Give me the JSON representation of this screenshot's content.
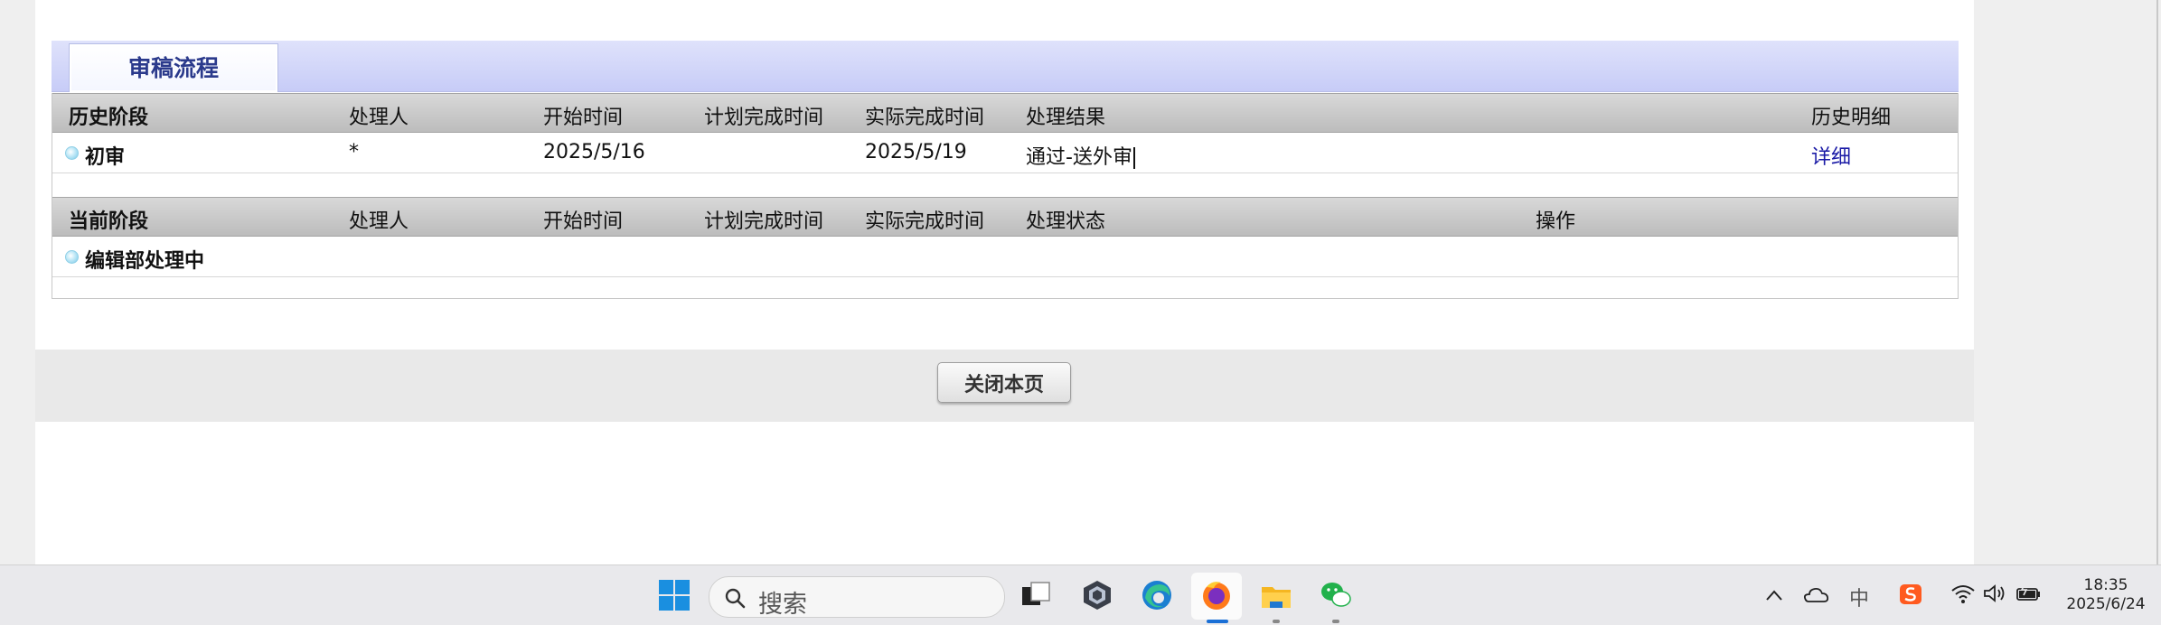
{
  "tab": {
    "label": "审稿流程"
  },
  "history": {
    "headers": [
      "历史阶段",
      "处理人",
      "开始时间",
      "计划完成时间",
      "实际完成时间",
      "处理结果",
      "历史明细"
    ],
    "row": {
      "stage": "初审",
      "handler": "*",
      "start": "2025/5/16",
      "planned": "",
      "actual": "2025/5/19",
      "result": "通过-送外审",
      "detail_link": "详细"
    }
  },
  "current": {
    "headers": [
      "当前阶段",
      "处理人",
      "开始时间",
      "计划完成时间",
      "实际完成时间",
      "处理状态",
      "操作"
    ],
    "row": {
      "stage": "编辑部处理中"
    }
  },
  "close_button": "关闭本页",
  "taskbar": {
    "search_placeholder": "搜索",
    "ime": "中",
    "clock_time": "18:35",
    "clock_date": "2025/6/24",
    "icons": [
      "windows-start-icon",
      "search-icon",
      "task-view-icon",
      "app-cube-icon",
      "edge-icon",
      "firefox-icon",
      "file-explorer-icon",
      "wechat-icon"
    ],
    "tray_icons": [
      "chevron-up-icon",
      "onedrive-cloud-icon",
      "ime-icon",
      "sogou-icon",
      "wifi-icon",
      "volume-icon",
      "battery-icon"
    ]
  },
  "colors": {
    "tab_text": "#2b3a8c",
    "link": "#1a1aa6",
    "tab_gradient_end": "#c7ccf7"
  }
}
